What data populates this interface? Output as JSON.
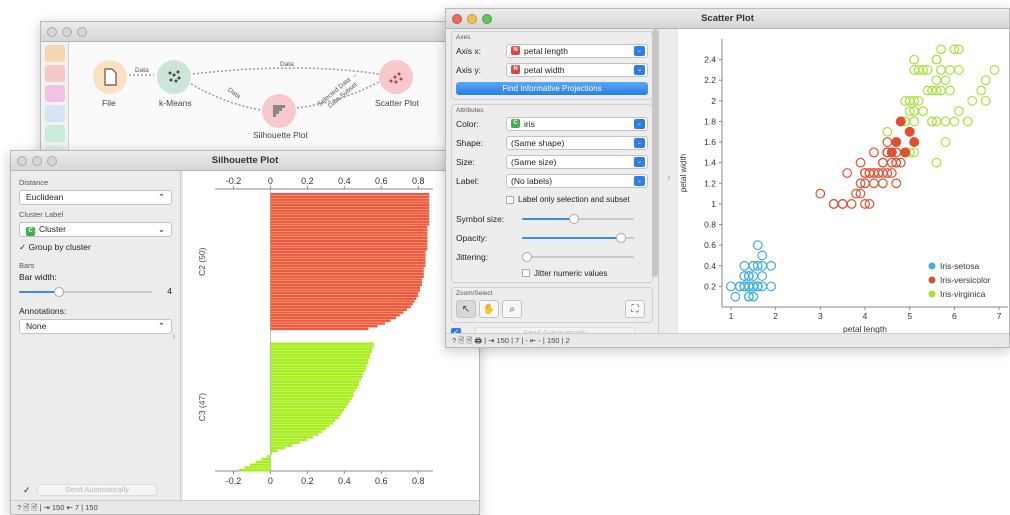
{
  "canvas": {
    "nodes": {
      "file": "File",
      "kmeans": "k-Means",
      "silhouette": "Silhouette Plot",
      "scatter": "Scatter Plot"
    },
    "links": {
      "file_kmeans": "Data",
      "kmeans_scatter": "Data",
      "kmeans_silhouette": "Data",
      "silhouette_scatter_a": "Selected Data →",
      "silhouette_scatter_b": "Data Subset"
    }
  },
  "silhouette": {
    "title": "Silhouette Plot",
    "distance_section": "Distance",
    "distance_value": "Euclidean",
    "cluster_label_section": "Cluster Label",
    "cluster_value": "Cluster",
    "group_by_cluster": "Group by cluster",
    "bars_section": "Bars",
    "bar_width_label": "Bar width:",
    "bar_width_value": "4",
    "bar_width_level": 0.3,
    "annotations_label": "Annotations:",
    "annotations_value": "None",
    "send_auto": "Send Automatically",
    "status": "? 🖹 🖹 | ⇥ 150 ⇤ 7 | 150",
    "chart_data": {
      "type": "bar",
      "orientation": "horizontal",
      "x_ticks": [
        "-0.2",
        "0",
        "0.2",
        "0.4",
        "0.6",
        "0.8"
      ],
      "xlim": [
        -0.3,
        0.88
      ],
      "groups": [
        {
          "name": "C2 (50)",
          "color": "#ee5a3c",
          "values": [
            0.86,
            0.86,
            0.86,
            0.86,
            0.86,
            0.86,
            0.86,
            0.86,
            0.86,
            0.86,
            0.86,
            0.86,
            0.85,
            0.85,
            0.85,
            0.85,
            0.85,
            0.85,
            0.85,
            0.85,
            0.85,
            0.84,
            0.84,
            0.84,
            0.84,
            0.84,
            0.84,
            0.83,
            0.83,
            0.83,
            0.83,
            0.82,
            0.82,
            0.82,
            0.81,
            0.81,
            0.8,
            0.8,
            0.79,
            0.78,
            0.77,
            0.76,
            0.74,
            0.72,
            0.7,
            0.68,
            0.65,
            0.62,
            0.58,
            0.53
          ]
        },
        {
          "name": "C3 (47)",
          "color": "#a8ee1e",
          "values": [
            0.56,
            0.56,
            0.55,
            0.55,
            0.54,
            0.54,
            0.53,
            0.53,
            0.52,
            0.52,
            0.51,
            0.5,
            0.5,
            0.49,
            0.48,
            0.48,
            0.47,
            0.46,
            0.45,
            0.45,
            0.44,
            0.43,
            0.42,
            0.41,
            0.4,
            0.39,
            0.38,
            0.37,
            0.35,
            0.34,
            0.32,
            0.3,
            0.28,
            0.26,
            0.23,
            0.2,
            0.16,
            0.12,
            0.08,
            0.04,
            0.01,
            -0.02,
            -0.05,
            -0.08,
            -0.11,
            -0.14,
            -0.17
          ]
        }
      ]
    }
  },
  "scatter": {
    "title": "Scatter Plot",
    "axis_section": "Axes",
    "axis_x_label": "Axis x:",
    "axis_x_value": "petal length",
    "axis_y_label": "Axis y:",
    "axis_y_value": "petal width",
    "find_projections": "Find Informative Projections",
    "attributes_section": "Attributes",
    "color_label": "Color:",
    "color_value": "iris",
    "shape_label": "Shape:",
    "shape_value": "(Same shape)",
    "size_label": "Size:",
    "size_value": "(Same size)",
    "label_label": "Label:",
    "label_value": "(No labels)",
    "label_only_selection": "Label only selection and subset",
    "symbol_size_label": "Symbol size:",
    "symbol_size_level": 0.5,
    "opacity_label": "Opacity:",
    "opacity_level": 0.95,
    "jittering_label": "Jittering:",
    "jittering_level": 0.0,
    "jitter_numeric": "Jitter numeric values",
    "zoom_select_section": "Zoom/Select",
    "send_auto": "Send Automatically",
    "status": "? 🖹 🖹 🖨 | ⇥ 150 | 7 | - ⇤ - | 150 | 2",
    "chart_data": {
      "type": "scatter",
      "xlabel": "petal length",
      "ylabel": "petal width",
      "xlim": [
        0.8,
        7.2
      ],
      "ylim": [
        0.0,
        2.6
      ],
      "x_ticks": [
        1,
        2,
        3,
        4,
        5,
        6,
        7
      ],
      "y_ticks": [
        0.2,
        0.4,
        0.6,
        0.8,
        1,
        1.2,
        1.4,
        1.6,
        1.8,
        2,
        2.2,
        2.4
      ],
      "legend_position": "bottom-right",
      "series": [
        {
          "name": "Iris-setosa",
          "color": "#40aee0",
          "points": [
            [
              1.4,
              0.2
            ],
            [
              1.4,
              0.2
            ],
            [
              1.3,
              0.2
            ],
            [
              1.5,
              0.2
            ],
            [
              1.4,
              0.2
            ],
            [
              1.7,
              0.4
            ],
            [
              1.4,
              0.3
            ],
            [
              1.5,
              0.2
            ],
            [
              1.4,
              0.2
            ],
            [
              1.5,
              0.1
            ],
            [
              1.5,
              0.2
            ],
            [
              1.6,
              0.2
            ],
            [
              1.4,
              0.1
            ],
            [
              1.1,
              0.1
            ],
            [
              1.2,
              0.2
            ],
            [
              1.5,
              0.4
            ],
            [
              1.3,
              0.4
            ],
            [
              1.4,
              0.3
            ],
            [
              1.7,
              0.3
            ],
            [
              1.5,
              0.3
            ],
            [
              1.7,
              0.2
            ],
            [
              1.5,
              0.4
            ],
            [
              1.0,
              0.2
            ],
            [
              1.7,
              0.5
            ],
            [
              1.9,
              0.2
            ],
            [
              1.6,
              0.2
            ],
            [
              1.6,
              0.4
            ],
            [
              1.5,
              0.2
            ],
            [
              1.4,
              0.2
            ],
            [
              1.6,
              0.2
            ],
            [
              1.6,
              0.2
            ],
            [
              1.5,
              0.4
            ],
            [
              1.5,
              0.1
            ],
            [
              1.4,
              0.2
            ],
            [
              1.5,
              0.2
            ],
            [
              1.2,
              0.2
            ],
            [
              1.3,
              0.2
            ],
            [
              1.4,
              0.1
            ],
            [
              1.3,
              0.2
            ],
            [
              1.5,
              0.2
            ],
            [
              1.3,
              0.3
            ],
            [
              1.3,
              0.3
            ],
            [
              1.3,
              0.2
            ],
            [
              1.6,
              0.6
            ],
            [
              1.9,
              0.4
            ],
            [
              1.4,
              0.3
            ],
            [
              1.6,
              0.2
            ],
            [
              1.4,
              0.2
            ],
            [
              1.5,
              0.2
            ],
            [
              1.4,
              0.2
            ]
          ]
        },
        {
          "name": "Iris-versicolor",
          "color": "#e05030",
          "points": [
            [
              4.7,
              1.4
            ],
            [
              4.5,
              1.5
            ],
            [
              4.9,
              1.5
            ],
            [
              4.0,
              1.3
            ],
            [
              4.6,
              1.5
            ],
            [
              4.5,
              1.3
            ],
            [
              4.7,
              1.6
            ],
            [
              3.3,
              1.0
            ],
            [
              4.6,
              1.3
            ],
            [
              3.9,
              1.4
            ],
            [
              3.5,
              1.0
            ],
            [
              4.2,
              1.5
            ],
            [
              4.0,
              1.0
            ],
            [
              4.7,
              1.4
            ],
            [
              3.6,
              1.3
            ],
            [
              4.4,
              1.4
            ],
            [
              4.5,
              1.5
            ],
            [
              4.1,
              1.0
            ],
            [
              4.5,
              1.5
            ],
            [
              3.9,
              1.1
            ],
            [
              4.8,
              1.8
            ],
            [
              4.0,
              1.3
            ],
            [
              4.9,
              1.5
            ],
            [
              4.7,
              1.2
            ],
            [
              4.3,
              1.3
            ],
            [
              4.4,
              1.4
            ],
            [
              4.8,
              1.4
            ],
            [
              5.0,
              1.7
            ],
            [
              4.5,
              1.5
            ],
            [
              3.5,
              1.0
            ],
            [
              3.8,
              1.1
            ],
            [
              3.7,
              1.0
            ],
            [
              3.9,
              1.2
            ],
            [
              5.1,
              1.6
            ],
            [
              4.5,
              1.5
            ],
            [
              4.5,
              1.6
            ],
            [
              4.7,
              1.5
            ],
            [
              4.4,
              1.3
            ],
            [
              4.1,
              1.3
            ],
            [
              4.0,
              1.3
            ],
            [
              4.4,
              1.2
            ],
            [
              4.6,
              1.4
            ],
            [
              4.0,
              1.2
            ],
            [
              3.3,
              1.0
            ],
            [
              4.2,
              1.3
            ],
            [
              4.2,
              1.2
            ],
            [
              4.2,
              1.3
            ],
            [
              4.3,
              1.3
            ],
            [
              3.0,
              1.1
            ],
            [
              4.1,
              1.3
            ]
          ]
        },
        {
          "name": "Iris-virginica",
          "color": "#a8e03c",
          "points": [
            [
              6.0,
              2.5
            ],
            [
              5.1,
              1.9
            ],
            [
              5.9,
              2.1
            ],
            [
              5.6,
              1.8
            ],
            [
              5.8,
              2.2
            ],
            [
              6.6,
              2.1
            ],
            [
              4.5,
              1.7
            ],
            [
              6.3,
              1.8
            ],
            [
              5.8,
              1.8
            ],
            [
              6.1,
              2.5
            ],
            [
              5.1,
              2.0
            ],
            [
              5.3,
              1.9
            ],
            [
              5.5,
              2.1
            ],
            [
              5.0,
              2.0
            ],
            [
              5.1,
              2.4
            ],
            [
              5.3,
              2.3
            ],
            [
              5.5,
              1.8
            ],
            [
              6.7,
              2.2
            ],
            [
              6.9,
              2.3
            ],
            [
              5.0,
              1.5
            ],
            [
              5.7,
              2.3
            ],
            [
              4.9,
              2.0
            ],
            [
              6.7,
              2.0
            ],
            [
              4.9,
              1.8
            ],
            [
              5.7,
              2.1
            ],
            [
              6.0,
              1.8
            ],
            [
              4.8,
              1.8
            ],
            [
              4.9,
              1.8
            ],
            [
              5.6,
              2.1
            ],
            [
              5.8,
              1.6
            ],
            [
              6.1,
              1.9
            ],
            [
              6.4,
              2.0
            ],
            [
              5.6,
              2.2
            ],
            [
              5.1,
              1.5
            ],
            [
              5.6,
              1.4
            ],
            [
              6.1,
              2.3
            ],
            [
              5.6,
              2.4
            ],
            [
              5.5,
              1.8
            ],
            [
              4.8,
              1.8
            ],
            [
              5.4,
              2.1
            ],
            [
              5.6,
              2.4
            ],
            [
              5.1,
              2.3
            ],
            [
              5.1,
              1.9
            ],
            [
              5.9,
              2.3
            ],
            [
              5.7,
              2.5
            ],
            [
              5.2,
              2.3
            ],
            [
              5.0,
              1.9
            ],
            [
              5.2,
              2.0
            ],
            [
              5.4,
              2.3
            ],
            [
              5.1,
              1.8
            ]
          ]
        }
      ],
      "selected_series": "Iris-versicolor",
      "selected_points": [
        [
          4.9,
          1.5
        ],
        [
          4.8,
          1.8
        ],
        [
          5.0,
          1.7
        ],
        [
          5.1,
          1.6
        ],
        [
          4.7,
          1.6
        ],
        [
          4.6,
          1.5
        ]
      ]
    }
  }
}
